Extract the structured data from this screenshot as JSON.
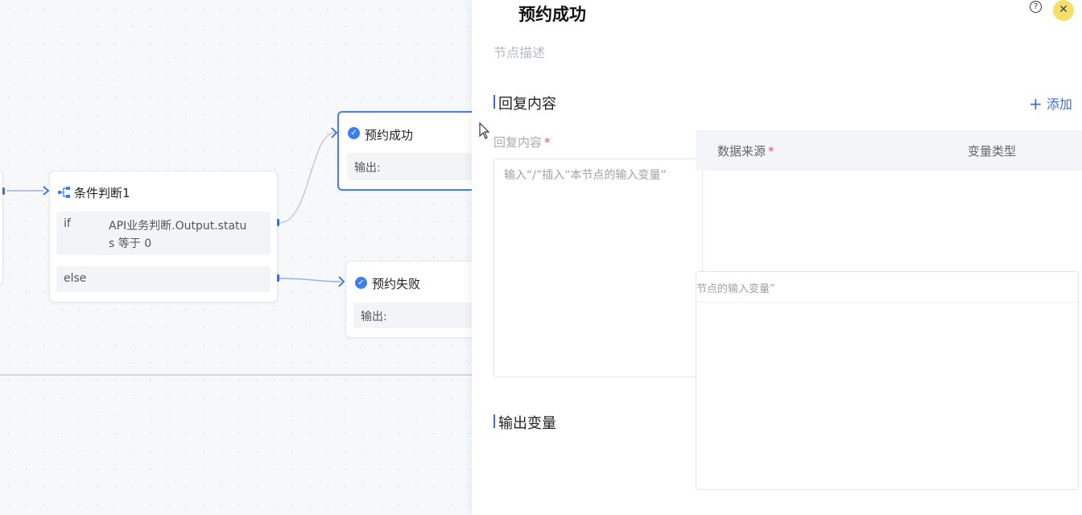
{
  "canvas": {
    "condition_node": {
      "title": "条件判断1",
      "if_label": "if",
      "if_condition_line1": "API业务判断.Output.statu",
      "if_condition_line2": "s 等于 0",
      "else_label": "else"
    },
    "success_node": {
      "title": "预约成功",
      "output_label": "输出:"
    },
    "fail_node": {
      "title": "预约失败",
      "output_label": "输出:"
    }
  },
  "panel": {
    "title": "预约成功",
    "description_placeholder": "节点描述",
    "reply_section": {
      "title": "回复内容",
      "add_label": "添加",
      "field_label": "回复内容",
      "placeholder": "输入“/”插入“本节点的输入变量”"
    },
    "input_table": {
      "col_source": "数据来源",
      "col_type": "变量类型",
      "ghost_placeholder": "节点的输入变量”"
    },
    "output_section": {
      "title": "输出变量"
    }
  },
  "colors": {
    "accent": "#3b6fd6",
    "check": "#3b7ef0",
    "required": "#e45656"
  }
}
